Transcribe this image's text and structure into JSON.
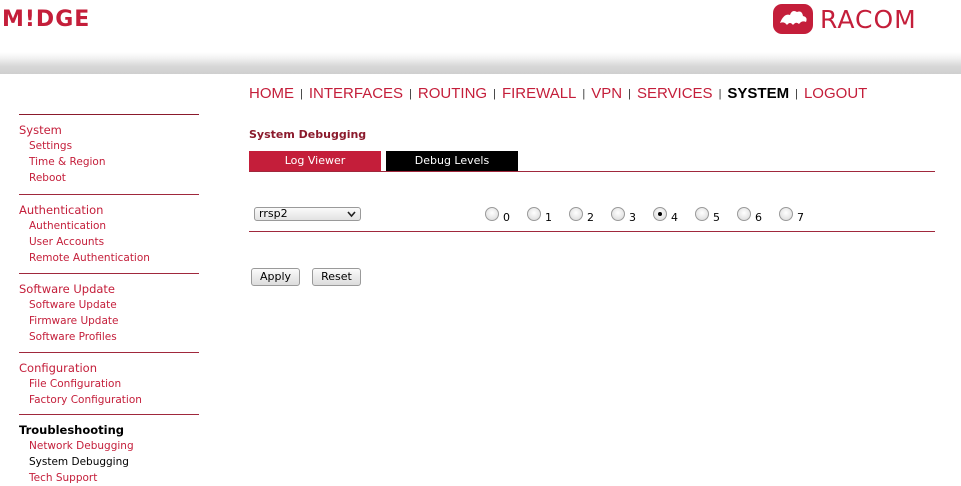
{
  "header": {
    "left_logo": "M!DGE",
    "right_logo": "RACOM"
  },
  "topnav": [
    {
      "label": "HOME",
      "active": false
    },
    {
      "label": "INTERFACES",
      "active": false
    },
    {
      "label": "ROUTING",
      "active": false
    },
    {
      "label": "FIREWALL",
      "active": false
    },
    {
      "label": "VPN",
      "active": false
    },
    {
      "label": "SERVICES",
      "active": false
    },
    {
      "label": "SYSTEM",
      "active": true
    },
    {
      "label": "LOGOUT",
      "active": false
    }
  ],
  "topnav_separator": "|",
  "sidebar": [
    {
      "title": "System",
      "items": [
        "Settings",
        "Time & Region",
        "Reboot"
      ]
    },
    {
      "title": "Authentication",
      "items": [
        "Authentication",
        "User Accounts",
        "Remote Authentication"
      ]
    },
    {
      "title": "Software Update",
      "items": [
        "Software Update",
        "Firmware Update",
        "Software Profiles"
      ]
    },
    {
      "title": "Configuration",
      "items": [
        "File Configuration",
        "Factory Configuration"
      ]
    },
    {
      "title": "Troubleshooting",
      "items": [
        "Network Debugging",
        "System Debugging",
        "Tech Support"
      ]
    }
  ],
  "main": {
    "page_title": "System Debugging",
    "tabs": [
      "Log Viewer",
      "Debug Levels"
    ],
    "debug_row": {
      "select_value": "rrsp2",
      "levels": [
        "0",
        "1",
        "2",
        "3",
        "4",
        "5",
        "6",
        "7"
      ],
      "selected_level": "4"
    },
    "apply_label": "Apply",
    "reset_label": "Reset"
  },
  "colors": {
    "accent": "#c41e3a",
    "rule": "#a0283c"
  }
}
